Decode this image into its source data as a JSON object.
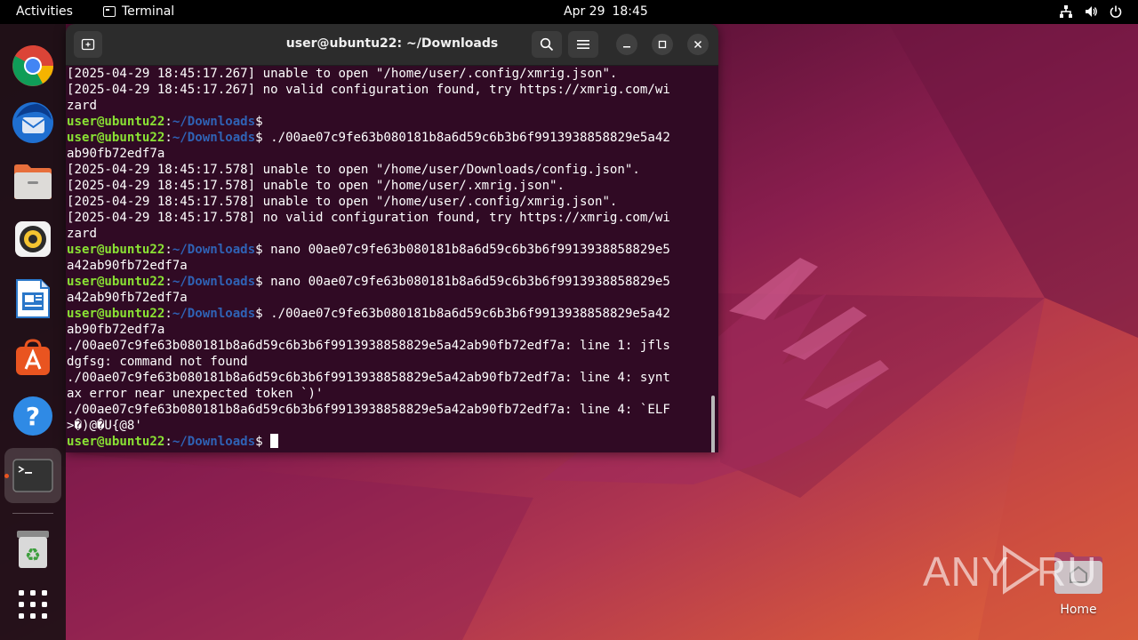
{
  "topbar": {
    "activities": "Activities",
    "app_name": "Terminal",
    "date": "Apr 29",
    "time": "18:45",
    "tray_icons": [
      "network-icon",
      "volume-icon",
      "power-icon"
    ]
  },
  "dock": {
    "items": [
      {
        "name": "chrome",
        "icon": "chrome-icon"
      },
      {
        "name": "thunderbird",
        "icon": "thunderbird-icon"
      },
      {
        "name": "files",
        "icon": "files-icon"
      },
      {
        "name": "rhythmbox",
        "icon": "rhythmbox-icon"
      },
      {
        "name": "libreoffice-writer",
        "icon": "writer-icon"
      },
      {
        "name": "app-center",
        "icon": "app-center-icon"
      },
      {
        "name": "help",
        "icon": "help-icon"
      },
      {
        "name": "terminal",
        "icon": "terminal-icon",
        "active": true
      },
      {
        "name": "trash",
        "icon": "trash-icon"
      },
      {
        "name": "show-apps",
        "icon": "grid-icon"
      }
    ]
  },
  "terminal": {
    "title": "user@ubuntu22: ~/Downloads",
    "prompt_user": "user@ubuntu22",
    "prompt_sep": ":",
    "prompt_path": "~/Downloads",
    "prompt_dollar": "$",
    "lines": [
      {
        "type": "out",
        "text": "[2025-04-29 18:45:17.267] unable to open \"/home/user/.config/xmrig.json\"."
      },
      {
        "type": "out",
        "text": "[2025-04-29 18:45:17.267] no valid configuration found, try https://xmrig.com/wi"
      },
      {
        "type": "out",
        "text": "zard"
      },
      {
        "type": "prompt",
        "cmd": ""
      },
      {
        "type": "prompt",
        "cmd": " ./00ae07c9fe63b080181b8a6d59c6b3b6f9913938858829e5a42"
      },
      {
        "type": "out",
        "text": "ab90fb72edf7a"
      },
      {
        "type": "out",
        "text": "[2025-04-29 18:45:17.578] unable to open \"/home/user/Downloads/config.json\"."
      },
      {
        "type": "out",
        "text": "[2025-04-29 18:45:17.578] unable to open \"/home/user/.xmrig.json\"."
      },
      {
        "type": "out",
        "text": "[2025-04-29 18:45:17.578] unable to open \"/home/user/.config/xmrig.json\"."
      },
      {
        "type": "out",
        "text": "[2025-04-29 18:45:17.578] no valid configuration found, try https://xmrig.com/wi"
      },
      {
        "type": "out",
        "text": "zard"
      },
      {
        "type": "prompt",
        "cmd": " nano 00ae07c9fe63b080181b8a6d59c6b3b6f9913938858829e5"
      },
      {
        "type": "out",
        "text": "a42ab90fb72edf7a"
      },
      {
        "type": "prompt",
        "cmd": " nano 00ae07c9fe63b080181b8a6d59c6b3b6f9913938858829e5"
      },
      {
        "type": "out",
        "text": "a42ab90fb72edf7a"
      },
      {
        "type": "prompt",
        "cmd": " ./00ae07c9fe63b080181b8a6d59c6b3b6f9913938858829e5a42"
      },
      {
        "type": "out",
        "text": "ab90fb72edf7a"
      },
      {
        "type": "out",
        "text": "./00ae07c9fe63b080181b8a6d59c6b3b6f9913938858829e5a42ab90fb72edf7a: line 1: jfls"
      },
      {
        "type": "out",
        "text": "dgfsg: command not found"
      },
      {
        "type": "out",
        "text": "./00ae07c9fe63b080181b8a6d59c6b3b6f9913938858829e5a42ab90fb72edf7a: line 4: synt"
      },
      {
        "type": "out",
        "text": "ax error near unexpected token `)'"
      },
      {
        "type": "out",
        "text": "./00ae07c9fe63b080181b8a6d59c6b3b6f9913938858829e5a42ab90fb72edf7a: line 4: `ELF"
      },
      {
        "type": "out",
        "text": ">�)@�U{@8'"
      },
      {
        "type": "prompt",
        "cmd": " ",
        "cursor": true
      }
    ]
  },
  "desktop": {
    "home_label": "Home",
    "watermark": "ANY RUN"
  },
  "colors": {
    "terminal_bg": "#300a24",
    "prompt_user": "#8ae234",
    "prompt_path": "#2f62b5",
    "accent": "#e95420"
  }
}
